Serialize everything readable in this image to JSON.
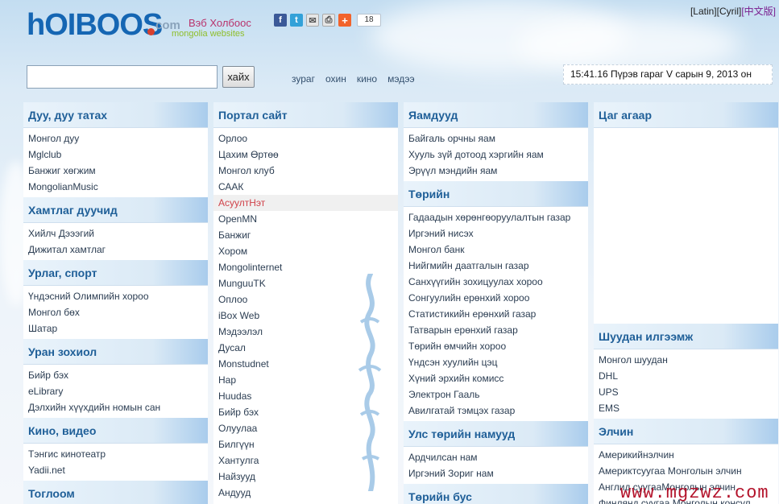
{
  "header": {
    "logo_main": "hOIBOOS",
    "logo_com": "com",
    "tagline": "Вэб Холбоос",
    "subtitle": "mongolia websites",
    "share_count": "18",
    "lang": {
      "latin": "[Latin]",
      "cyril": "[Cyril]",
      "chinese": "[中文版]"
    }
  },
  "search": {
    "placeholder": "",
    "value": "",
    "button_label": "хайх",
    "nav": [
      "зураг",
      "охин",
      "кино",
      "мэдээ"
    ]
  },
  "clock": "15:41.16  Пүрэв гараг V сарын 9, 2013 он",
  "social_icons": [
    "facebook-icon",
    "twitter-icon",
    "email-icon",
    "print-icon",
    "share-plus-icon"
  ],
  "columns": [
    {
      "sections": [
        {
          "title": "Дуу, дуу татах",
          "items": [
            "Монгол дуу",
            "Mglclub",
            "Банжиг хөгжим",
            "MongolianMusic"
          ]
        },
        {
          "title": "Хамтлаг дуучид",
          "items": [
            "Хийлч Дэээгий",
            "Дижитал хамтлаг"
          ]
        },
        {
          "title": "Урлаг, спорт",
          "items": [
            "Үндэсний Олимпийн хороо",
            "Монгол бөх",
            "Шатар"
          ]
        },
        {
          "title": "Уран зохиол",
          "items": [
            "Бийр бэх",
            "eLibrary",
            "Дэлхийн хүүхдийн номын сан"
          ]
        },
        {
          "title": "Кино, видео",
          "items": [
            "Тэнгис кинотеатр",
            "Yadii.net"
          ]
        },
        {
          "title": "Тоглоом",
          "items": []
        }
      ]
    },
    {
      "sections": [
        {
          "title": "Портал сайт",
          "items": [
            "Орлоо",
            "Цахим Өртөө",
            "Монгол клуб",
            "СААК",
            "АсуултНэт",
            "OpenMN",
            "Банжиг",
            "Хором",
            "Mongolinternet",
            "MunguuTK",
            "Оплоо",
            "iBox Web",
            "Мэдээлэл",
            "Дусал",
            "Monstudnet",
            "Нар",
            "Huudas",
            "Бийр бэх",
            "Олуулаа",
            "Билгүүн",
            "Хантулга",
            "Найзууд",
            "Андууд"
          ],
          "highlight": 4
        }
      ]
    },
    {
      "sections": [
        {
          "title": "Яамдууд",
          "items": [
            "Байгаль орчны яам",
            "Хууль зүй дотоод хэргийн яам",
            "Эрүүл мэндийн яам"
          ]
        },
        {
          "title": "Төрийн",
          "items": [
            "Гадаадын хөрөнгөоруулалтын газар",
            "Иргэний нисэх",
            "Монгол банк",
            "Нийгмийн даатгалын газар",
            "Санхүүгийн зохицуулах хороо",
            "Сонгуулийн ерөнхий хороо",
            "Статистикийн ерөнхий газар",
            "Татварын ерөнхий газар",
            "Төрийн өмчийн хороо",
            "Үндсэн хуулийн цэц",
            "Хүний эрхийн комисс",
            "Электрон Гааль",
            "Авилгатай тэмцэх газар"
          ]
        },
        {
          "title": "Улс төрийн намууд",
          "items": [
            "Ардчилсан нам",
            "Иргэний Зориг нам"
          ]
        },
        {
          "title": "Төрийн бус",
          "items": []
        }
      ]
    },
    {
      "sections": [
        {
          "title": "Цаг агаар",
          "items": []
        },
        {
          "title": "Шуудан илгээмж",
          "items": [
            "Монгол шуудан",
            "DHL",
            "UPS",
            "EMS"
          ]
        },
        {
          "title": "Элчин",
          "items": [
            "Америкийнэлчин",
            "Америктсуугаа Монголын элчин",
            "Англид суугааМонголын элчин",
            "Финлянд суугаа Монголын консул"
          ]
        }
      ]
    }
  ],
  "watermark": "www.mgzwz.com"
}
